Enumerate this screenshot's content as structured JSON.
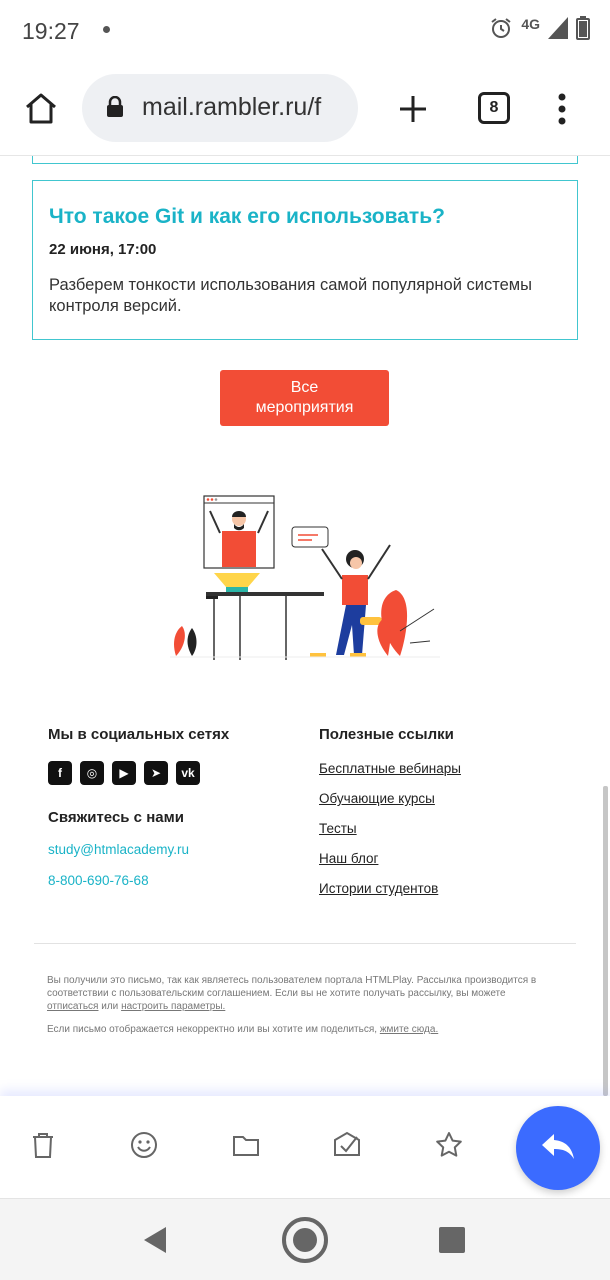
{
  "status_bar": {
    "time": "19:27",
    "network": "4G"
  },
  "browser": {
    "url": "mail.rambler.ru/f",
    "tab_count": "8"
  },
  "event": {
    "title": "Что такое Git и как его использовать?",
    "date": "22 июня, 17:00",
    "description": "Разберем тонкости использования самой популярной системы контроля версий."
  },
  "cta": {
    "line1": "Все",
    "line2": "мероприятия"
  },
  "footer": {
    "social_title": "Мы в социальных сетях",
    "social_icons": [
      "facebook-icon",
      "instagram-icon",
      "youtube-icon",
      "telegram-icon",
      "vk-icon"
    ],
    "contact_title": "Свяжитесь с нами",
    "email": "study@htmlacademy.ru",
    "phone": "8-800-690-76-68",
    "links_title": "Полезные ссылки",
    "links": [
      "Бесплатные вебинары",
      "Обучающие курсы",
      "Тесты",
      "Наш блог",
      "Истории студентов"
    ]
  },
  "legal": {
    "text1": "Вы получили это письмо, так как являетесь пользователем портала HTMLPlay. Рассылка производится в соответствии с пользовательским соглашением. Если вы не хотите получать рассылку, вы можете",
    "unsubscribe": "отписаться",
    "or": "или",
    "settings": "настроить параметры.",
    "text2": "Если письмо отображается некорректно или вы хотите им поделиться,",
    "click_here": "жмите сюда."
  },
  "colors": {
    "accent": "#1ab3c7",
    "button": "#f24d36",
    "reply": "#3b6bff"
  }
}
